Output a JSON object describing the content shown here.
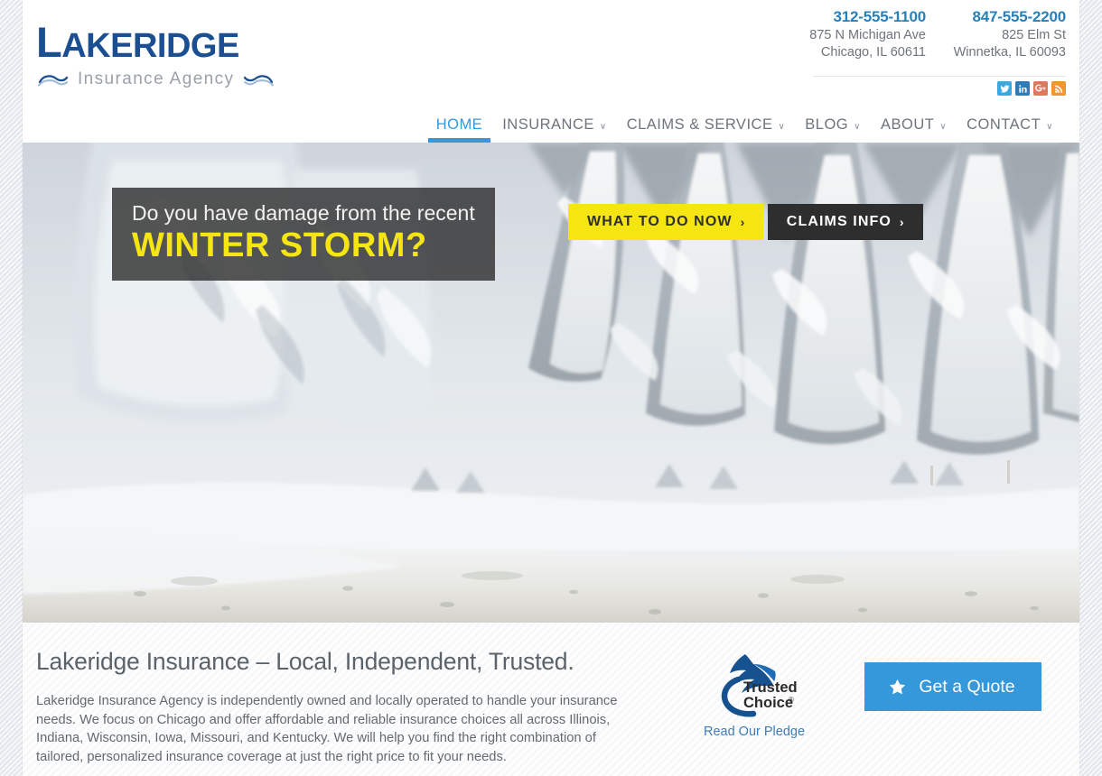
{
  "brand": {
    "logo_main": "LAKERIDGE",
    "logo_sub": "Insurance Agency",
    "logo_color": "#1b4f92",
    "accent_color": "#3498db",
    "highlight_color": "#f5e612"
  },
  "header": {
    "contacts": [
      {
        "phone": "312-555-1100",
        "address_line1": "875 N Michigan Ave",
        "address_line2": "Chicago, IL 60611"
      },
      {
        "phone": "847-555-2200",
        "address_line1": "825 Elm St",
        "address_line2": "Winnetka, IL 60093"
      }
    ],
    "social": [
      {
        "name": "twitter",
        "glyph": "t",
        "color": "#3aa9e0"
      },
      {
        "name": "linkedin",
        "glyph": "in",
        "color": "#2e7bb5"
      },
      {
        "name": "google-plus",
        "glyph": "G+",
        "color": "#e0775f"
      },
      {
        "name": "rss",
        "glyph": "rss",
        "color": "#f2952f"
      }
    ],
    "nav": [
      {
        "label": "HOME",
        "active": true,
        "caret": ""
      },
      {
        "label": "INSURANCE",
        "active": false,
        "caret": "∨"
      },
      {
        "label": "CLAIMS & SERVICE",
        "active": false,
        "caret": "∨"
      },
      {
        "label": "BLOG",
        "active": false,
        "caret": "∨"
      },
      {
        "label": "ABOUT",
        "active": false,
        "caret": "∨"
      },
      {
        "label": "CONTACT",
        "active": false,
        "caret": "∨"
      }
    ]
  },
  "hero": {
    "caption_line1": "Do you have damage from the recent",
    "caption_line2": "WINTER STORM?",
    "buttons": [
      {
        "label": "WHAT TO DO NOW",
        "arrow": "›",
        "style": "yellow"
      },
      {
        "label": "CLAIMS INFO",
        "arrow": "›",
        "style": "dark"
      }
    ],
    "image_alt": "snow covered evergreen forest beside a snowy road"
  },
  "main": {
    "title": "Lakeridge Insurance – Local, Independent, Trusted.",
    "body": "Lakeridge Insurance Agency is independently owned and locally operated to handle your insurance needs. We focus on Chicago and offer affordable and reliable insurance choices all across Illinois, Indiana, Wisconsin, Iowa, Missouri, and Kentucky. We will help you find the right combination of tailored, personalized insurance coverage at just the right price to fit your needs.",
    "badge": {
      "line1": "Trusted",
      "line2": "Choice",
      "registered": "®",
      "pledge_link": "Read Our Pledge"
    },
    "quote_button": {
      "label": "Get a Quote",
      "icon": "star"
    }
  }
}
